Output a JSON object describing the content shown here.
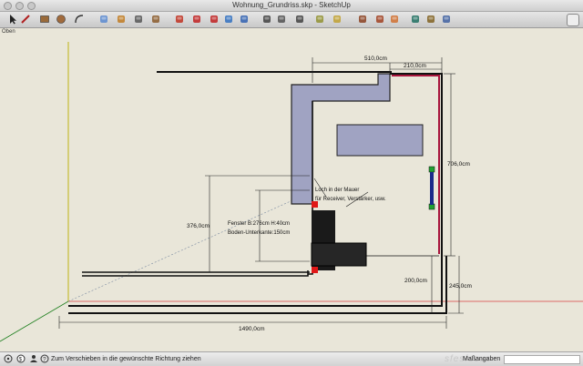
{
  "window": {
    "title": "Wohnung_Grundriss.skp - SketchUp"
  },
  "toolbar": {
    "tools": [
      {
        "icon": "select-arrow-icon",
        "color": "#222222"
      },
      {
        "icon": "pencil-line-icon",
        "color": "#b02020"
      },
      {
        "icon": "rectangle-icon",
        "color": "#9a6a3a"
      },
      {
        "icon": "circle-icon",
        "color": "#a06a3c"
      },
      {
        "icon": "arc-icon",
        "color": "#333333"
      },
      {
        "icon": "eraser-icon",
        "color": "#5a8ad0"
      },
      {
        "icon": "paint-bucket-icon",
        "color": "#c07a20"
      },
      {
        "icon": "tape-measure-icon",
        "color": "#555555"
      },
      {
        "icon": "protractor-icon",
        "color": "#8a5a2a"
      },
      {
        "icon": "push-pull-icon",
        "color": "#c03020"
      },
      {
        "icon": "move-icon",
        "color": "#c02020"
      },
      {
        "icon": "rotate-icon",
        "color": "#c02020"
      },
      {
        "icon": "follow-me-icon",
        "color": "#3070c0"
      },
      {
        "icon": "scale-icon",
        "color": "#3060b0"
      },
      {
        "icon": "orbit-icon",
        "color": "#404040"
      },
      {
        "icon": "pan-hand-icon",
        "color": "#505050"
      },
      {
        "icon": "zoom-magnifier-icon",
        "color": "#404040"
      },
      {
        "icon": "zoom-extents-icon",
        "color": "#909030"
      },
      {
        "icon": "previous-view-icon",
        "color": "#c0a030"
      },
      {
        "icon": "walk-icon",
        "color": "#8a4020"
      },
      {
        "icon": "position-camera-icon",
        "color": "#a04020"
      },
      {
        "icon": "look-around-icon",
        "color": "#d07030"
      },
      {
        "icon": "components-icon",
        "color": "#207060"
      },
      {
        "icon": "materials-icon",
        "color": "#806020"
      },
      {
        "icon": "styles-icon",
        "color": "#4060a0"
      }
    ]
  },
  "viewport": {
    "label": "Oben",
    "dimensions": {
      "top_width": "510,0cm",
      "top_right_width": "210,0cm",
      "right_height": "706,0cm",
      "left_height": "376,0cm",
      "inner_height": "200,0cm",
      "right_lower_height": "245,0cm",
      "bottom_width": "1490,0cm"
    },
    "annotations": {
      "hole_line1": "Loch in der Mauer",
      "hole_line2": "für Receiver, Verstärker, usw.",
      "window_line1": "Fenster B:276cm H:40cm",
      "window_line2": "Boden-Unterkante:150cm"
    },
    "colors": {
      "wall_fill": "#a0a3c2",
      "accent_wall": "#a8143c",
      "axis_red": "#d84040",
      "axis_green": "#208020",
      "axis_yellow": "#c8c040",
      "marker_red": "#e01818",
      "marker_green": "#20a030",
      "speaker_blue": "#1a2a8a"
    }
  },
  "status": {
    "hint": "Zum Verschieben in die gewünschte Richtung ziehen",
    "measurements_label": "Maßangaben",
    "measurements_value": "",
    "watermark": "sfesfocus"
  }
}
